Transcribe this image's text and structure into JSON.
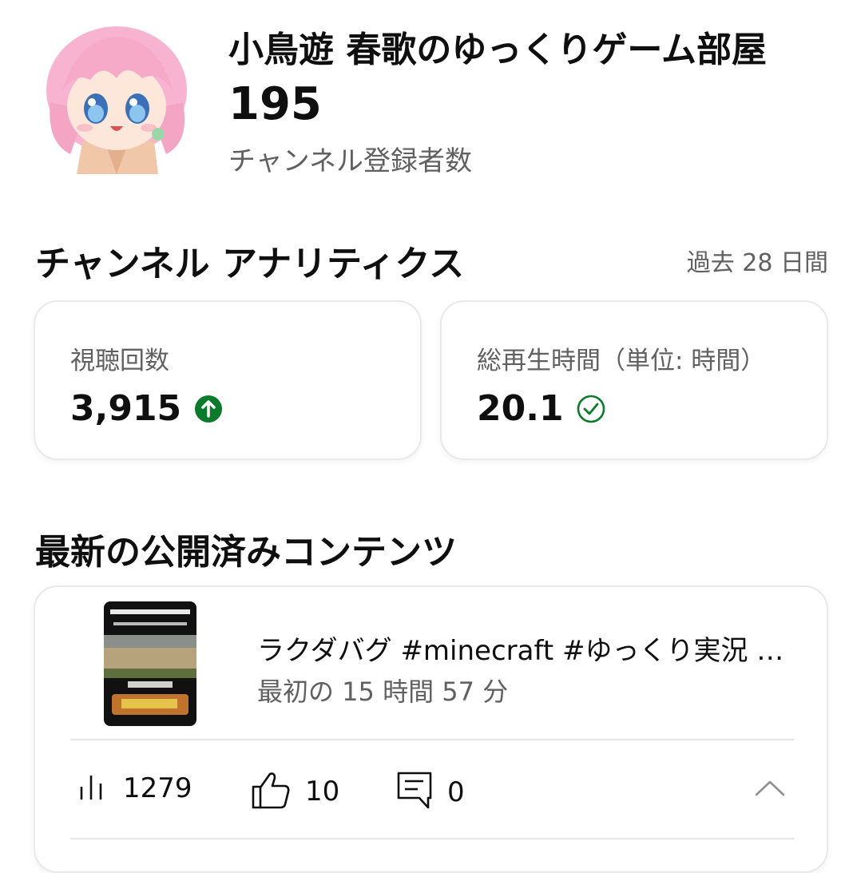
{
  "channel": {
    "name": "小鳥遊 春歌のゆっくりゲーム部屋",
    "subscriber_count": "195",
    "subscriber_label": "チャンネル登録者数"
  },
  "analytics": {
    "title": "チャンネル アナリティクス",
    "period": "過去 28 日間",
    "views": {
      "label": "視聴回数",
      "value": "3,915",
      "status_icon": "arrow-up-circle-icon",
      "status_color": "#0b7a2a"
    },
    "watch_time": {
      "label": "総再生時間（単位: 時間）",
      "value": "20.1",
      "status_icon": "check-circle-icon",
      "status_color": "#0b7a2a"
    }
  },
  "latest": {
    "title": "最新の公開済みコンテンツ",
    "video": {
      "title": "ラクダバグ #minecraft #ゆっくり実況 …",
      "time": "最初の 15 時間 57 分",
      "views": "1279",
      "likes": "10",
      "comments": "0"
    }
  }
}
